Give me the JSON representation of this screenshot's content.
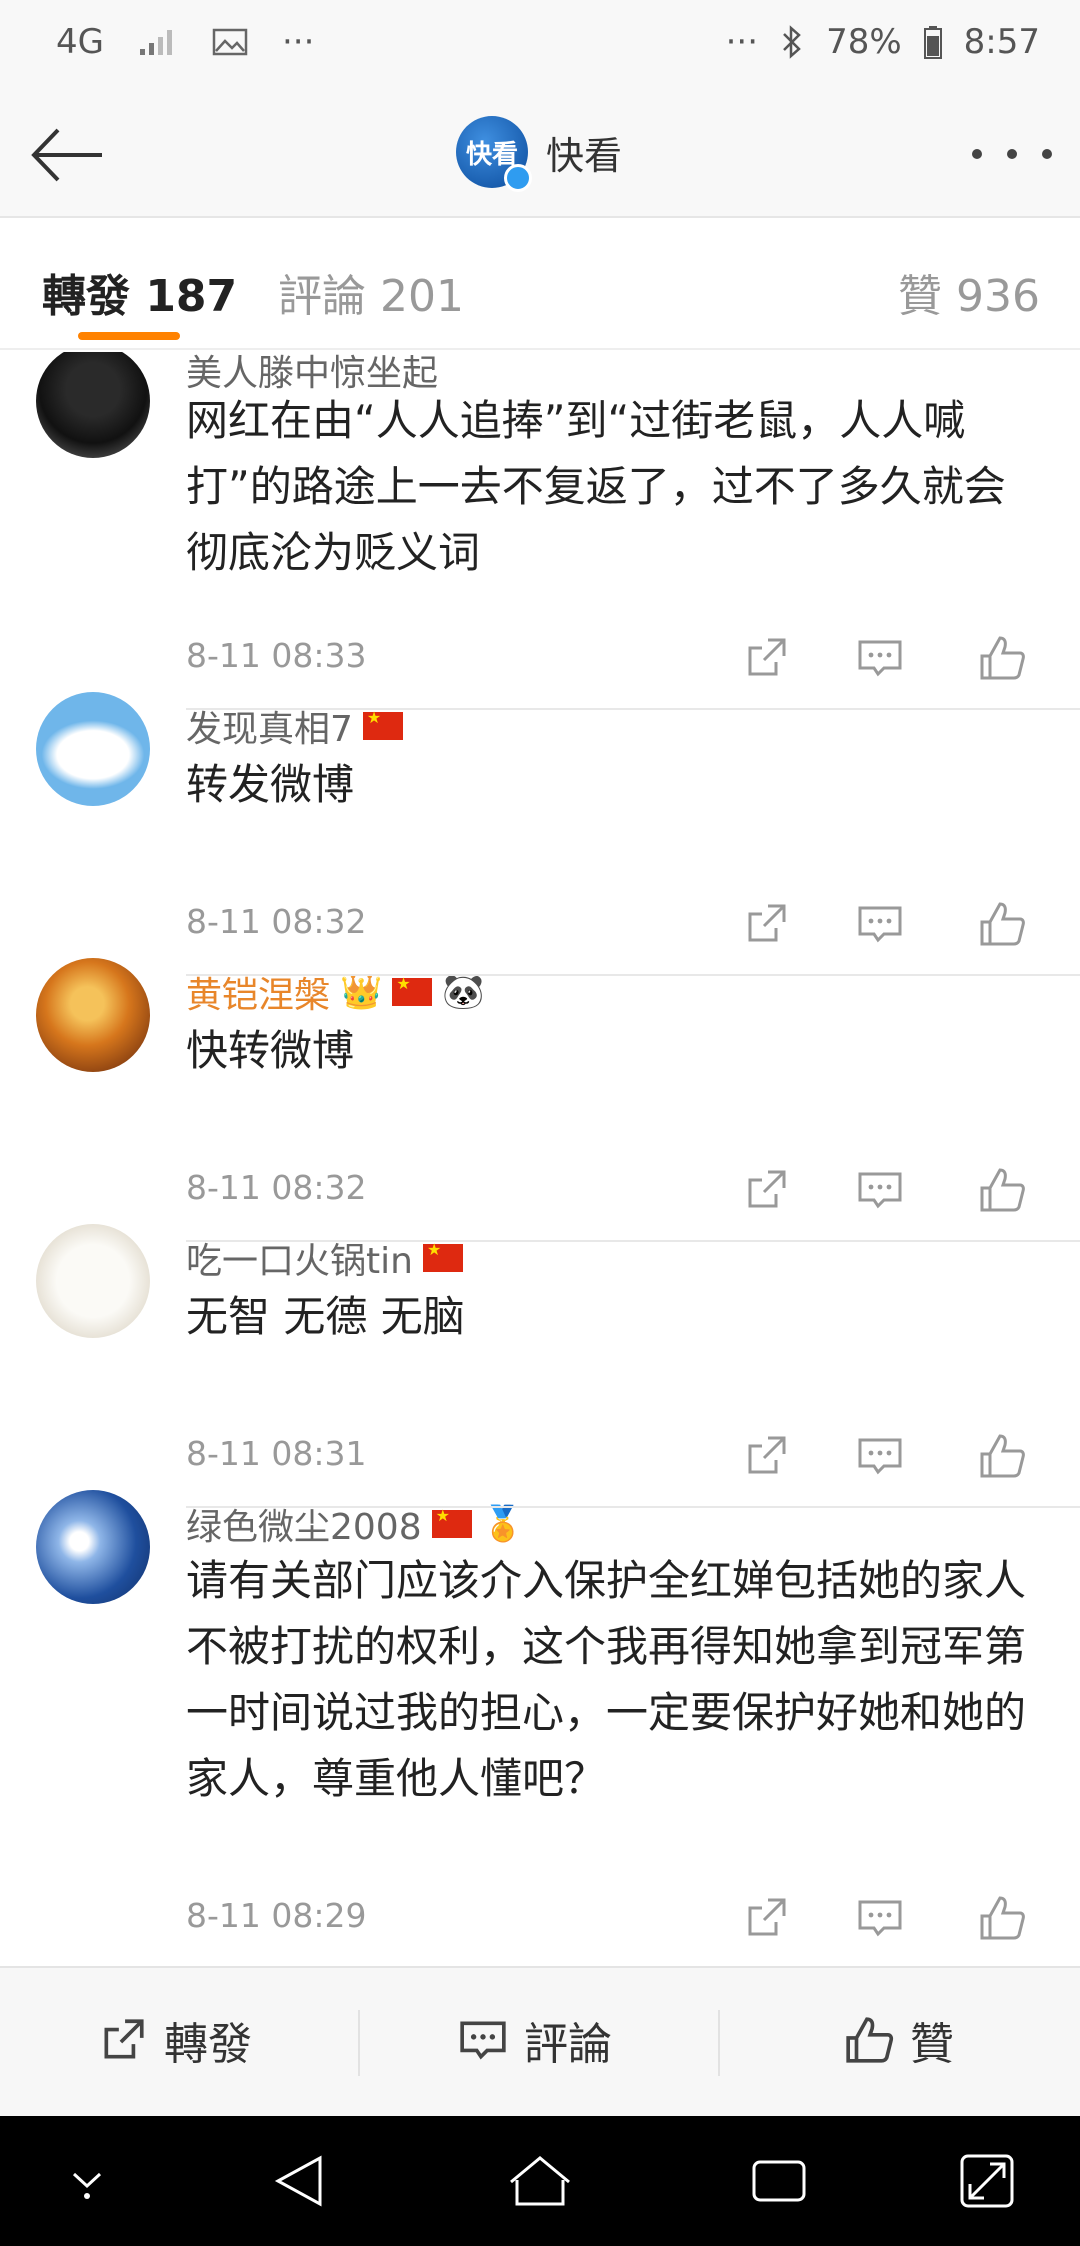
{
  "status_bar": {
    "network": "4G",
    "dots_left": "···",
    "dots_right": "···",
    "battery": "78%",
    "time": "8:57"
  },
  "header": {
    "logo_text": "快看",
    "title": "快看"
  },
  "tabs": {
    "reposts": "轉發 187",
    "comments": "評論 201",
    "likes": "贊 936"
  },
  "comments": [
    {
      "user": "美人滕中惊坐起",
      "text": "网红在由“人人追捧”到“过街老鼠，人人喊打”的路途上一去不复返了，过不了多久就会彻底沦为贬义词",
      "time": "8-11 08:33",
      "badges": []
    },
    {
      "user": "发现真相7",
      "text": "转发微博",
      "time": "8-11 08:32",
      "badges": [
        "flag"
      ]
    },
    {
      "user": "黄铠涅槃",
      "text": "快转微博",
      "time": "8-11 08:32",
      "badges": [
        "crown",
        "flag",
        "panda"
      ]
    },
    {
      "user": "吃一口火锅tin",
      "text": "无智 无德 无脑",
      "time": "8-11 08:31",
      "badges": [
        "flag"
      ]
    },
    {
      "user": "绿色微尘2008",
      "text": "请有关部门应该介入保护全红婵包括她的家人不被打扰的权利，这个我再得知她拿到冠军第一时间说过我的担心，一定要保护好她和她的家人，尊重他人懂吧？",
      "time": "8-11 08:29",
      "badges": [
        "flag",
        "medal"
      ]
    }
  ],
  "toolbar": {
    "repost": "轉發",
    "comment": "評論",
    "like": "贊"
  },
  "badge_glyphs": {
    "crown": "👑",
    "panda": "🐼",
    "medal": "🏅"
  },
  "colors": {
    "accent": "#ff8200",
    "gold_name": "#e8862a"
  }
}
